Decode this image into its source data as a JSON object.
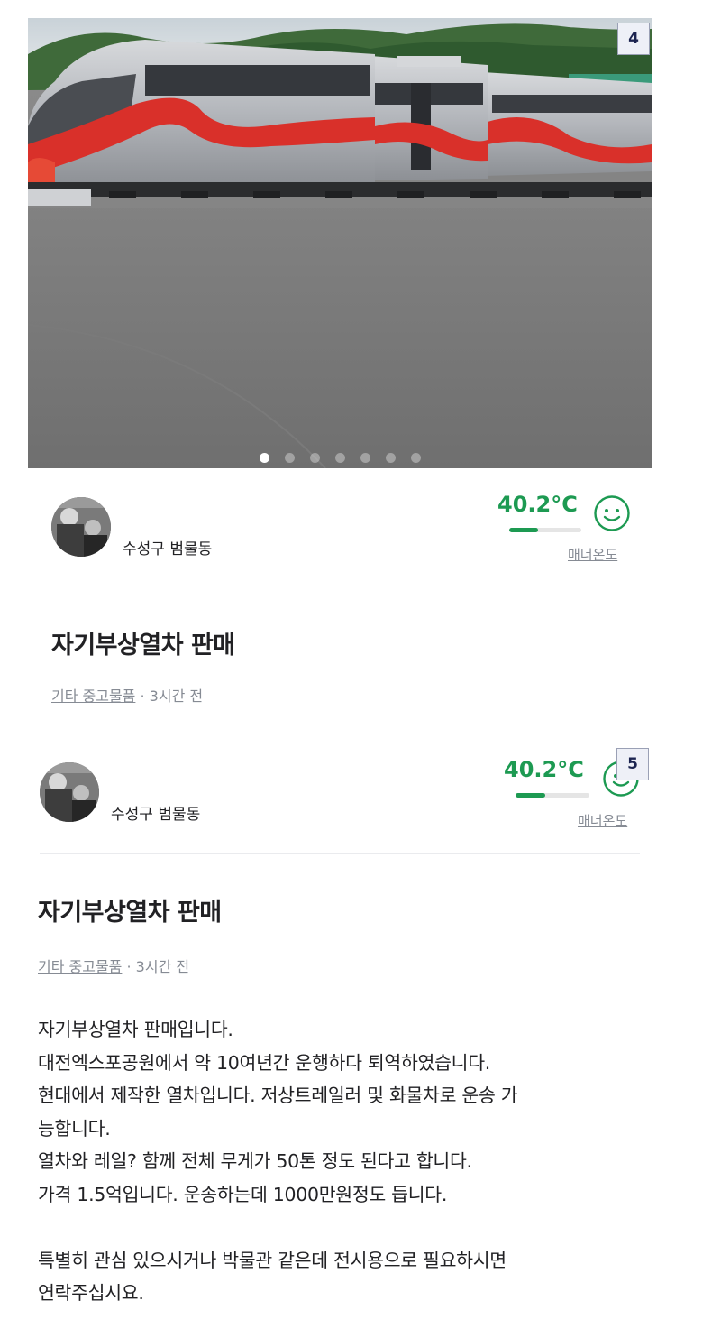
{
  "badges": {
    "first": "4",
    "second": "5"
  },
  "gallery": {
    "dot_count": 7,
    "active_index": 0
  },
  "listing": {
    "location": "수성구 범물동",
    "temperature": "40.2°C",
    "temperature_fill": 0.402,
    "manner_label": "매너온도",
    "title": "자기부상열차 판매",
    "category": "기타 중고물품",
    "time_ago": "· 3시간 전",
    "description": [
      "자기부상열차 판매입니다.",
      "대전엑스포공원에서 약 10여년간 운행하다 퇴역하였습니다.",
      "현대에서 제작한 열차입니다. 저상트레일러 및 화물차로 운송 가",
      "능합니다.",
      "열차와 레일? 함께 전체 무게가 50톤 정도 된다고 합니다.",
      "가격 1.5억입니다. 운송하는데 1000만원정도 듭니다.",
      "",
      "특별히 관심 있으시거나 박물관 같은데 전시용으로 필요하시면",
      "연락주십시요."
    ]
  },
  "colors": {
    "temperature_green": "#1d9a52",
    "muted_text": "#868b94",
    "train_red": "#d9302a",
    "train_silver": "#b9bcc1"
  },
  "icons": {
    "smiley": "smiley-face-icon"
  }
}
